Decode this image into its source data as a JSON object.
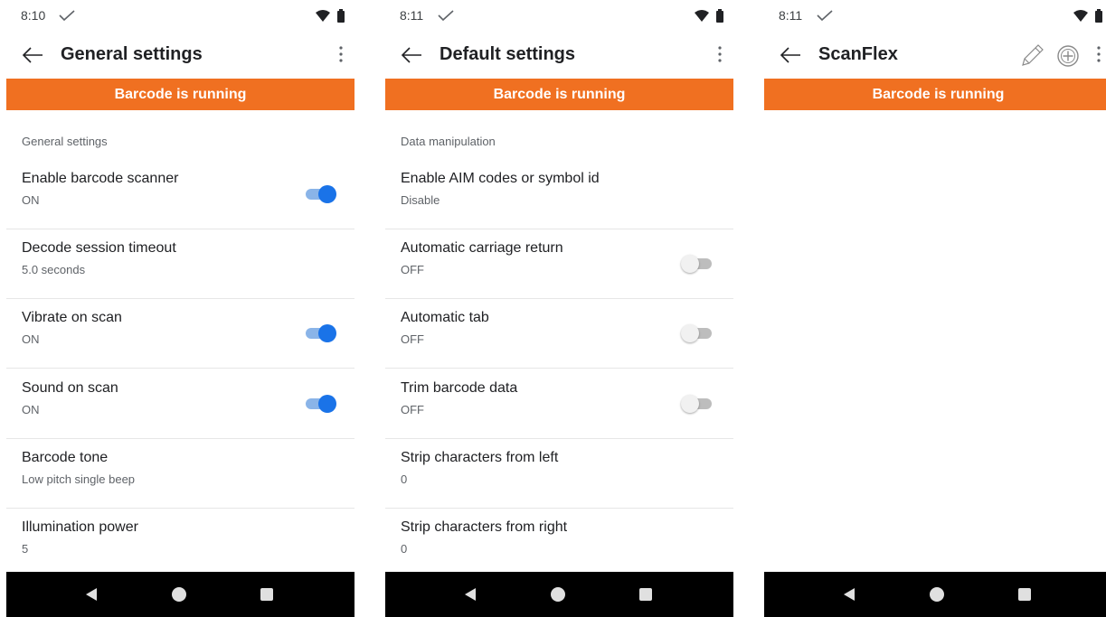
{
  "screens": [
    {
      "status": {
        "time": "8:10"
      },
      "title": "General settings",
      "banner": "Barcode is running",
      "section_header": "General settings",
      "rows": [
        {
          "label": "Enable barcode scanner",
          "value": "ON",
          "toggle": "on"
        },
        {
          "label": "Decode session timeout",
          "value": "5.0 seconds"
        },
        {
          "label": "Vibrate on scan",
          "value": "ON",
          "toggle": "on"
        },
        {
          "label": "Sound on scan",
          "value": "ON",
          "toggle": "on"
        },
        {
          "label": "Barcode tone",
          "value": "Low pitch single beep"
        },
        {
          "label": "Illumination power",
          "value": "5"
        }
      ]
    },
    {
      "status": {
        "time": "8:11"
      },
      "title": "Default settings",
      "banner": "Barcode is running",
      "section_header": "Data manipulation",
      "rows": [
        {
          "label": "Enable AIM codes or symbol id",
          "value": "Disable"
        },
        {
          "label": "Automatic carriage return",
          "value": "OFF",
          "toggle": "off"
        },
        {
          "label": "Automatic tab",
          "value": "OFF",
          "toggle": "off"
        },
        {
          "label": "Trim barcode data",
          "value": "OFF",
          "toggle": "off"
        },
        {
          "label": "Strip characters from left",
          "value": "0"
        },
        {
          "label": "Strip characters from right",
          "value": "0"
        }
      ]
    },
    {
      "status": {
        "time": "8:11"
      },
      "title": "ScanFlex",
      "banner": "Barcode is running",
      "actions": [
        "pencil-icon",
        "add-circle-icon",
        "more-vert-icon"
      ]
    }
  ],
  "icons": {
    "status_left": "check-icon",
    "status_right": [
      "wifi-icon",
      "battery-icon"
    ],
    "appbar_back": "arrow-back-icon",
    "appbar_more": "more-vert-icon",
    "nav": [
      "nav-back-icon",
      "nav-home-icon",
      "nav-recents-icon"
    ]
  },
  "colors": {
    "banner": "#f07021",
    "toggle_on": "#1a73e8",
    "navbar": "#000000"
  }
}
